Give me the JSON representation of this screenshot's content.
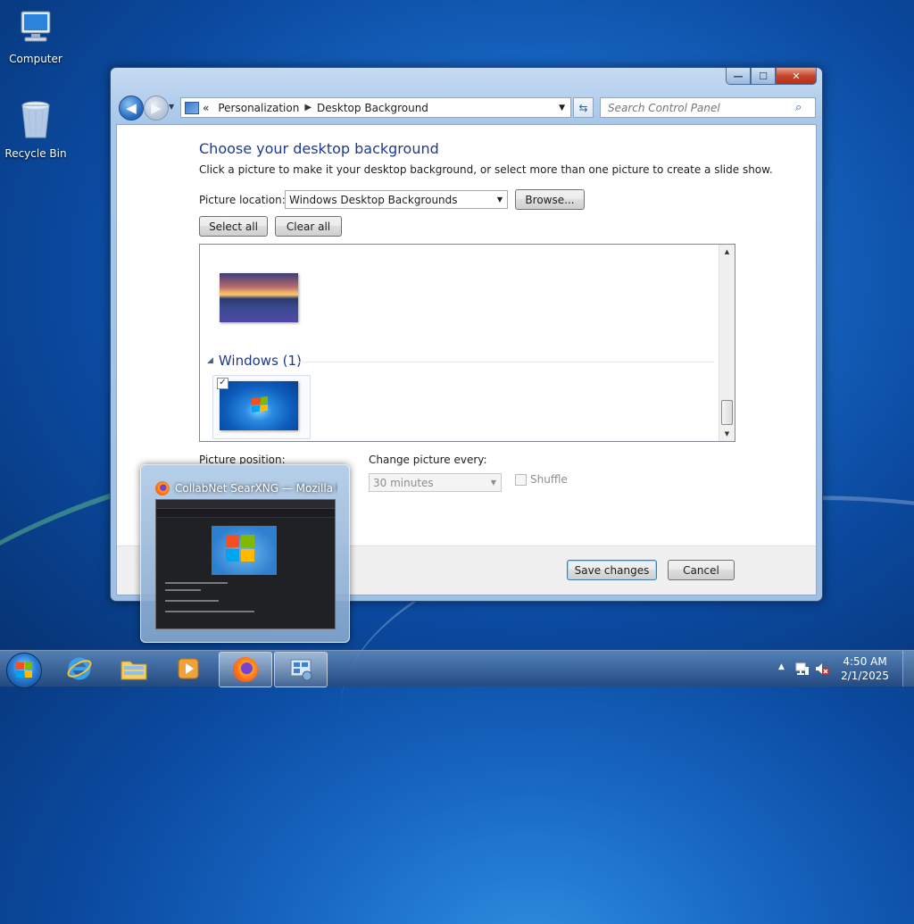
{
  "desktop": {
    "icons": [
      {
        "label": "Computer"
      },
      {
        "label": "Recycle Bin"
      }
    ]
  },
  "window": {
    "caption_buttons": {
      "minimize": "—",
      "maximize": "☐",
      "close": "✕"
    },
    "nav": {
      "back": "◀",
      "forward": "▶"
    },
    "address": {
      "chevron": "«",
      "crumbs": [
        "Personalization",
        "Desktop Background"
      ]
    },
    "search": {
      "placeholder": "Search Control Panel"
    },
    "heading": "Choose your desktop background",
    "description": "Click a picture to make it your desktop background, or select more than one picture to create a slide show.",
    "picture_location_label": "Picture location:",
    "picture_location_value": "Windows Desktop Backgrounds",
    "browse_label": "Browse...",
    "select_all_label": "Select all",
    "clear_all_label": "Clear all",
    "group_title": "Windows (1)",
    "picture_position_label": "Picture position:",
    "change_picture_label": "Change picture every:",
    "change_picture_value": "30 minutes",
    "shuffle_label": "Shuffle",
    "save_label": "Save changes",
    "cancel_label": "Cancel"
  },
  "preview": {
    "title": "CollabNet SearXNG — Mozilla F..."
  },
  "taskbar": {
    "time": "4:50 AM",
    "date": "2/1/2025",
    "tray_arrow": "▲"
  },
  "colors": {
    "accent": "#1e3a8a",
    "flag_red": "#f25022",
    "flag_green": "#7fba00",
    "flag_blue": "#00a4ef",
    "flag_yellow": "#ffb900"
  }
}
